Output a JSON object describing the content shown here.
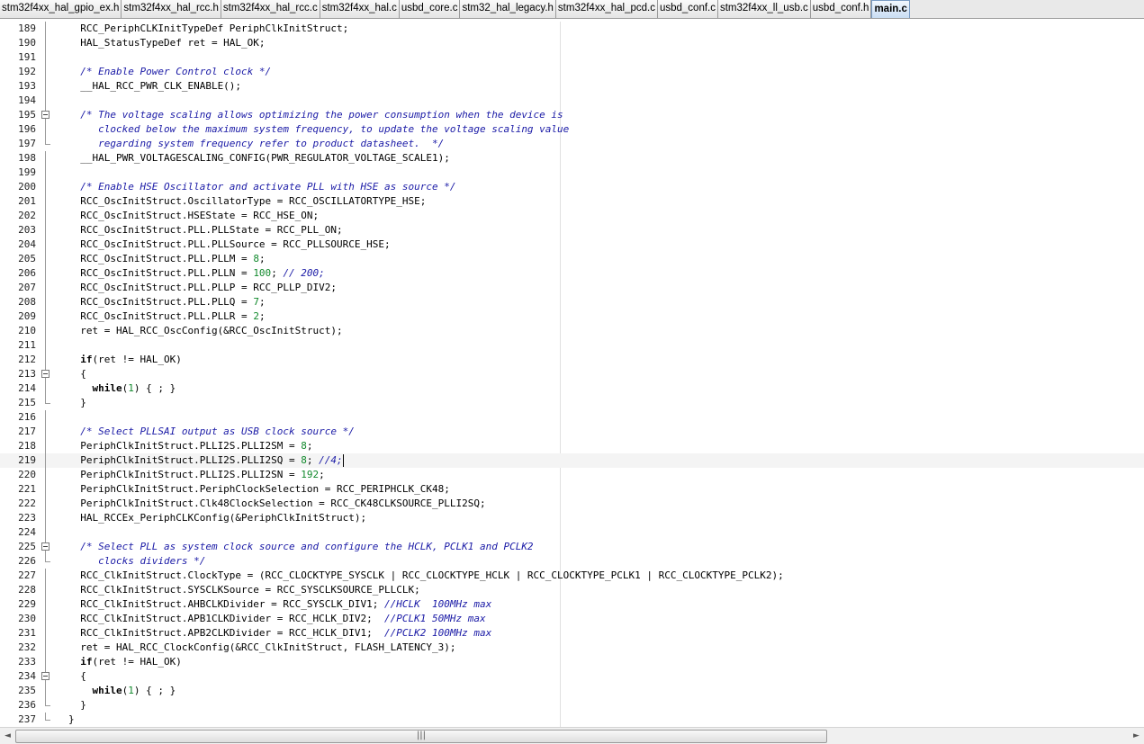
{
  "tabs": [
    {
      "label": "stm32f4xx_hal_gpio_ex.h",
      "active": false
    },
    {
      "label": "stm32f4xx_hal_rcc.h",
      "active": false
    },
    {
      "label": "stm32f4xx_hal_rcc.c",
      "active": false
    },
    {
      "label": "stm32f4xx_hal.c",
      "active": false
    },
    {
      "label": "usbd_core.c",
      "active": false
    },
    {
      "label": "stm32_hal_legacy.h",
      "active": false
    },
    {
      "label": "stm32f4xx_hal_pcd.c",
      "active": false
    },
    {
      "label": "usbd_conf.c",
      "active": false
    },
    {
      "label": "stm32f4xx_ll_usb.c",
      "active": false
    },
    {
      "label": "usbd_conf.h",
      "active": false
    },
    {
      "label": "main.c",
      "active": true
    }
  ],
  "editor": {
    "current_line": 219,
    "lines": [
      {
        "n": "189",
        "fold": "line",
        "seg": [
          [
            "",
            "  RCC_PeriphCLKInitTypeDef PeriphClkInitStruct;"
          ]
        ]
      },
      {
        "n": "190",
        "fold": "line",
        "seg": [
          [
            "",
            "  HAL_StatusTypeDef ret = HAL_OK;"
          ]
        ]
      },
      {
        "n": "191",
        "fold": "line",
        "seg": []
      },
      {
        "n": "192",
        "fold": "line",
        "seg": [
          [
            "cm",
            "  /* Enable Power Control clock */"
          ]
        ]
      },
      {
        "n": "193",
        "fold": "line",
        "seg": [
          [
            "",
            "  __HAL_RCC_PWR_CLK_ENABLE();"
          ]
        ]
      },
      {
        "n": "194",
        "fold": "line",
        "seg": []
      },
      {
        "n": "195",
        "fold": "open",
        "seg": [
          [
            "cm",
            "  /* The voltage scaling allows optimizing the power consumption when the device is"
          ]
        ]
      },
      {
        "n": "196",
        "fold": "line",
        "seg": [
          [
            "cm",
            "     clocked below the maximum system frequency, to update the voltage scaling value"
          ]
        ]
      },
      {
        "n": "197",
        "fold": "end",
        "seg": [
          [
            "cm",
            "     regarding system frequency refer to product datasheet.  */"
          ]
        ]
      },
      {
        "n": "198",
        "fold": "line",
        "seg": [
          [
            "",
            "  __HAL_PWR_VOLTAGESCALING_CONFIG(PWR_REGULATOR_VOLTAGE_SCALE1);"
          ]
        ]
      },
      {
        "n": "199",
        "fold": "line",
        "seg": []
      },
      {
        "n": "200",
        "fold": "line",
        "seg": [
          [
            "cm",
            "  /* Enable HSE Oscillator and activate PLL with HSE as source */"
          ]
        ]
      },
      {
        "n": "201",
        "fold": "line",
        "seg": [
          [
            "",
            "  RCC_OscInitStruct.OscillatorType = RCC_OSCILLATORTYPE_HSE;"
          ]
        ]
      },
      {
        "n": "202",
        "fold": "line",
        "seg": [
          [
            "",
            "  RCC_OscInitStruct.HSEState = RCC_HSE_ON;"
          ]
        ]
      },
      {
        "n": "203",
        "fold": "line",
        "seg": [
          [
            "",
            "  RCC_OscInitStruct.PLL.PLLState = RCC_PLL_ON;"
          ]
        ]
      },
      {
        "n": "204",
        "fold": "line",
        "seg": [
          [
            "",
            "  RCC_OscInitStruct.PLL.PLLSource = RCC_PLLSOURCE_HSE;"
          ]
        ]
      },
      {
        "n": "205",
        "fold": "line",
        "seg": [
          [
            "",
            "  RCC_OscInitStruct.PLL.PLLM = "
          ],
          [
            "num",
            "8"
          ],
          [
            "",
            ";"
          ]
        ]
      },
      {
        "n": "206",
        "fold": "line",
        "seg": [
          [
            "",
            "  RCC_OscInitStruct.PLL.PLLN = "
          ],
          [
            "num",
            "100"
          ],
          [
            "",
            "; "
          ],
          [
            "cm",
            "// 200;"
          ]
        ]
      },
      {
        "n": "207",
        "fold": "line",
        "seg": [
          [
            "",
            "  RCC_OscInitStruct.PLL.PLLP = RCC_PLLP_DIV2;"
          ]
        ]
      },
      {
        "n": "208",
        "fold": "line",
        "seg": [
          [
            "",
            "  RCC_OscInitStruct.PLL.PLLQ = "
          ],
          [
            "num",
            "7"
          ],
          [
            "",
            ";"
          ]
        ]
      },
      {
        "n": "209",
        "fold": "line",
        "seg": [
          [
            "",
            "  RCC_OscInitStruct.PLL.PLLR = "
          ],
          [
            "num",
            "2"
          ],
          [
            "",
            ";"
          ]
        ]
      },
      {
        "n": "210",
        "fold": "line",
        "seg": [
          [
            "",
            "  ret = HAL_RCC_OscConfig(&RCC_OscInitStruct);"
          ]
        ]
      },
      {
        "n": "211",
        "fold": "line",
        "seg": []
      },
      {
        "n": "212",
        "fold": "line",
        "seg": [
          [
            "kw",
            "  if"
          ],
          [
            "",
            "(ret != HAL_OK)"
          ]
        ]
      },
      {
        "n": "213",
        "fold": "open",
        "seg": [
          [
            "",
            "  {"
          ]
        ]
      },
      {
        "n": "214",
        "fold": "line",
        "seg": [
          [
            "kw",
            "    while"
          ],
          [
            "",
            "("
          ],
          [
            "num",
            "1"
          ],
          [
            "",
            ") { ; }"
          ]
        ]
      },
      {
        "n": "215",
        "fold": "end",
        "seg": [
          [
            "",
            "  }"
          ]
        ]
      },
      {
        "n": "216",
        "fold": "line",
        "seg": []
      },
      {
        "n": "217",
        "fold": "line",
        "seg": [
          [
            "cm",
            "  /* Select PLLSAI output as USB clock source */"
          ]
        ]
      },
      {
        "n": "218",
        "fold": "line",
        "seg": [
          [
            "",
            "  PeriphClkInitStruct.PLLI2S.PLLI2SM = "
          ],
          [
            "num",
            "8"
          ],
          [
            "",
            ";"
          ]
        ]
      },
      {
        "n": "219",
        "fold": "line",
        "seg": [
          [
            "",
            "  PeriphClkInitStruct.PLLI2S.PLLI2SQ = "
          ],
          [
            "num",
            "8"
          ],
          [
            "",
            "; "
          ],
          [
            "cm",
            "//4;"
          ]
        ]
      },
      {
        "n": "220",
        "fold": "line",
        "seg": [
          [
            "",
            "  PeriphClkInitStruct.PLLI2S.PLLI2SN = "
          ],
          [
            "num",
            "192"
          ],
          [
            "",
            ";"
          ]
        ]
      },
      {
        "n": "221",
        "fold": "line",
        "seg": [
          [
            "",
            "  PeriphClkInitStruct.PeriphClockSelection = RCC_PERIPHCLK_CK48;"
          ]
        ]
      },
      {
        "n": "222",
        "fold": "line",
        "seg": [
          [
            "",
            "  PeriphClkInitStruct.Clk48ClockSelection = RCC_CK48CLKSOURCE_PLLI2SQ;"
          ]
        ]
      },
      {
        "n": "223",
        "fold": "line",
        "seg": [
          [
            "",
            "  HAL_RCCEx_PeriphCLKConfig(&PeriphClkInitStruct);"
          ]
        ]
      },
      {
        "n": "224",
        "fold": "line",
        "seg": []
      },
      {
        "n": "225",
        "fold": "open",
        "seg": [
          [
            "cm",
            "  /* Select PLL as system clock source and configure the HCLK, PCLK1 and PCLK2"
          ]
        ]
      },
      {
        "n": "226",
        "fold": "end",
        "seg": [
          [
            "cm",
            "     clocks dividers */"
          ]
        ]
      },
      {
        "n": "227",
        "fold": "line",
        "seg": [
          [
            "",
            "  RCC_ClkInitStruct.ClockType = (RCC_CLOCKTYPE_SYSCLK | RCC_CLOCKTYPE_HCLK | RCC_CLOCKTYPE_PCLK1 | RCC_CLOCKTYPE_PCLK2);"
          ]
        ]
      },
      {
        "n": "228",
        "fold": "line",
        "seg": [
          [
            "",
            "  RCC_ClkInitStruct.SYSCLKSource = RCC_SYSCLKSOURCE_PLLCLK;"
          ]
        ]
      },
      {
        "n": "229",
        "fold": "line",
        "seg": [
          [
            "",
            "  RCC_ClkInitStruct.AHBCLKDivider = RCC_SYSCLK_DIV1; "
          ],
          [
            "cm",
            "//HCLK  100MHz max"
          ]
        ]
      },
      {
        "n": "230",
        "fold": "line",
        "seg": [
          [
            "",
            "  RCC_ClkInitStruct.APB1CLKDivider = RCC_HCLK_DIV2;  "
          ],
          [
            "cm",
            "//PCLK1 50MHz max"
          ]
        ]
      },
      {
        "n": "231",
        "fold": "line",
        "seg": [
          [
            "",
            "  RCC_ClkInitStruct.APB2CLKDivider = RCC_HCLK_DIV1;  "
          ],
          [
            "cm",
            "//PCLK2 100MHz max"
          ]
        ]
      },
      {
        "n": "232",
        "fold": "line",
        "seg": [
          [
            "",
            "  ret = HAL_RCC_ClockConfig(&RCC_ClkInitStruct, FLASH_LATENCY_3);"
          ]
        ]
      },
      {
        "n": "233",
        "fold": "line",
        "seg": [
          [
            "kw",
            "  if"
          ],
          [
            "",
            "(ret != HAL_OK)"
          ]
        ]
      },
      {
        "n": "234",
        "fold": "open",
        "seg": [
          [
            "",
            "  {"
          ]
        ]
      },
      {
        "n": "235",
        "fold": "line",
        "seg": [
          [
            "kw",
            "    while"
          ],
          [
            "",
            "("
          ],
          [
            "num",
            "1"
          ],
          [
            "",
            ") { ; }"
          ]
        ]
      },
      {
        "n": "236",
        "fold": "end",
        "seg": [
          [
            "",
            "  }"
          ]
        ]
      },
      {
        "n": "237",
        "fold": "end",
        "seg": [
          [
            "",
            "}"
          ]
        ]
      }
    ]
  },
  "scrollbar": {
    "left_arrow": "◄",
    "right_arrow": "►",
    "grip": "|||",
    "thumb_fraction": 0.73
  }
}
